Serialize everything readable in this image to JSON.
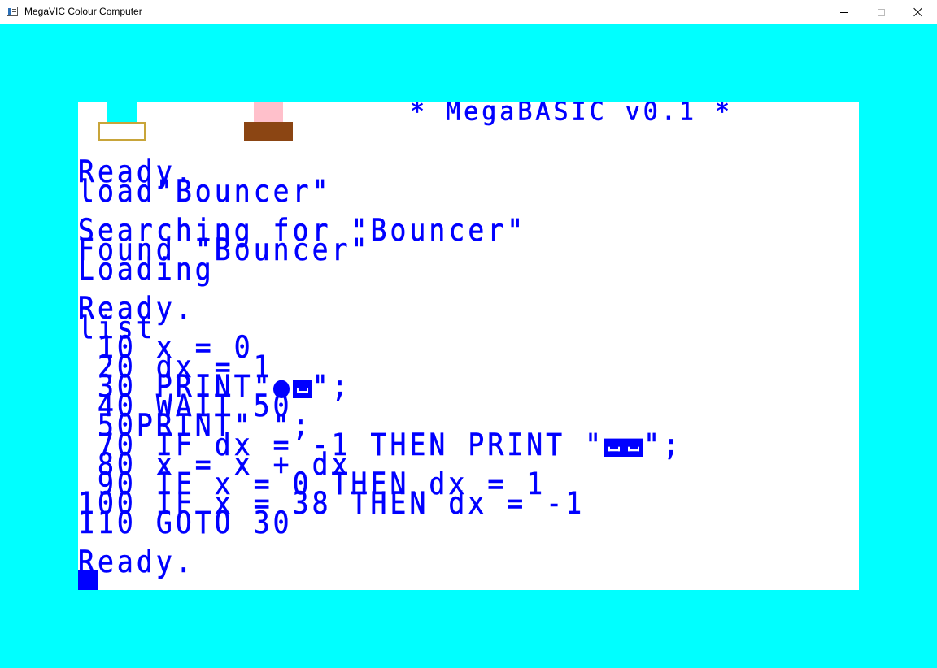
{
  "window": {
    "title": "MegaVIC Colour Computer",
    "controls": {
      "minimize_icon": "minimize-icon",
      "maximize_icon": "maximize-icon",
      "close_icon": "close-icon"
    }
  },
  "colors": {
    "border": "#00ffff",
    "screen": "#ffffff",
    "text": "#0000ff",
    "sprite_cyan": "#00ffff",
    "sprite_gold": "#c8a53a",
    "sprite_pink": "#ffc0cb",
    "sprite_brown": "#8b4513"
  },
  "screen": {
    "banner": "* MegaBASIC v0.1 *",
    "lines": [
      "Ready.",
      "load\"Bouncer\"",
      "",
      "Searching for \"Bouncer\"",
      "Found \"Bouncer\"",
      "Loading",
      "",
      "Ready.",
      "list",
      " 10 x = 0",
      " 20 dx = 1",
      " 30 PRINT\"",
      " 40 WAIT 50",
      " 50PRINT\" \";",
      " 70 IF dx = -1 THEN PRINT \"",
      " 80 x = x + dx",
      " 90 IF x = 0 THEN dx = 1",
      "100 IF x = 38 THEN dx = -1",
      "110 GOTO 30",
      "",
      "Ready."
    ],
    "line30_suffix": "\";",
    "line70_suffix": "\";"
  }
}
